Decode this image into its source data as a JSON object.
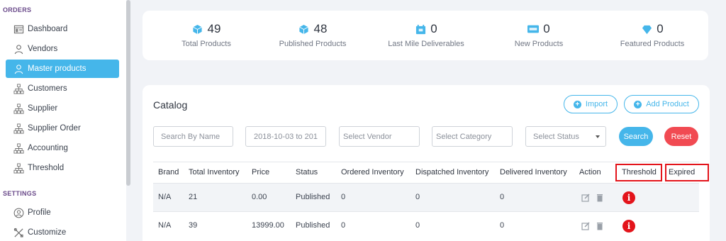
{
  "sidebar": {
    "orders_title": "ORDERS",
    "settings_title": "SETTINGS",
    "items": [
      {
        "label": "Dashboard",
        "icon": "dashboard-icon"
      },
      {
        "label": "Vendors",
        "icon": "user-icon"
      },
      {
        "label": "Master products",
        "icon": "user-icon",
        "active": true
      },
      {
        "label": "Customers",
        "icon": "hierarchy-icon"
      },
      {
        "label": "Supplier",
        "icon": "hierarchy-icon"
      },
      {
        "label": "Supplier Order",
        "icon": "hierarchy-icon"
      },
      {
        "label": "Accounting",
        "icon": "hierarchy-icon"
      },
      {
        "label": "Threshold",
        "icon": "hierarchy-icon"
      }
    ],
    "settings_items": [
      {
        "label": "Profile",
        "icon": "profile-icon"
      },
      {
        "label": "Customize",
        "icon": "tools-icon"
      }
    ]
  },
  "stats": [
    {
      "value": "49",
      "label": "Total Products",
      "icon": "cube-icon"
    },
    {
      "value": "48",
      "label": "Published Products",
      "icon": "cube-icon"
    },
    {
      "value": "0",
      "label": "Last Mile Deliverables",
      "icon": "calendar-icon"
    },
    {
      "value": "0",
      "label": "New Products",
      "icon": "new-badge-icon"
    },
    {
      "value": "0",
      "label": "Featured Products",
      "icon": "diamond-icon"
    }
  ],
  "catalog": {
    "title": "Catalog",
    "import_label": "Import",
    "add_label": "Add Product",
    "search_name_placeholder": "Search By Name",
    "date_range": "2018-10-03 to 201",
    "vendor_placeholder": "Select Vendor",
    "category_placeholder": "Select Category",
    "status_placeholder": "Select Status",
    "search_label": "Search",
    "reset_label": "Reset",
    "columns": [
      "Brand",
      "Total Inventory",
      "Price",
      "Status",
      "Ordered Inventory",
      "Dispatched Inventory",
      "Delivered Inventory",
      "Action",
      "Threshold",
      "Expired"
    ],
    "rows": [
      {
        "brand": "N/A",
        "total": "21",
        "price": "0.00",
        "status": "Published",
        "ordered": "0",
        "dispatched": "0",
        "delivered": "0"
      },
      {
        "brand": "N/A",
        "total": "39",
        "price": "13999.00",
        "status": "Published",
        "ordered": "0",
        "dispatched": "0",
        "delivered": "0"
      }
    ]
  },
  "colors": {
    "accent": "#45b6ea",
    "danger": "#f14a52",
    "highlight_box": "#e3141b"
  }
}
